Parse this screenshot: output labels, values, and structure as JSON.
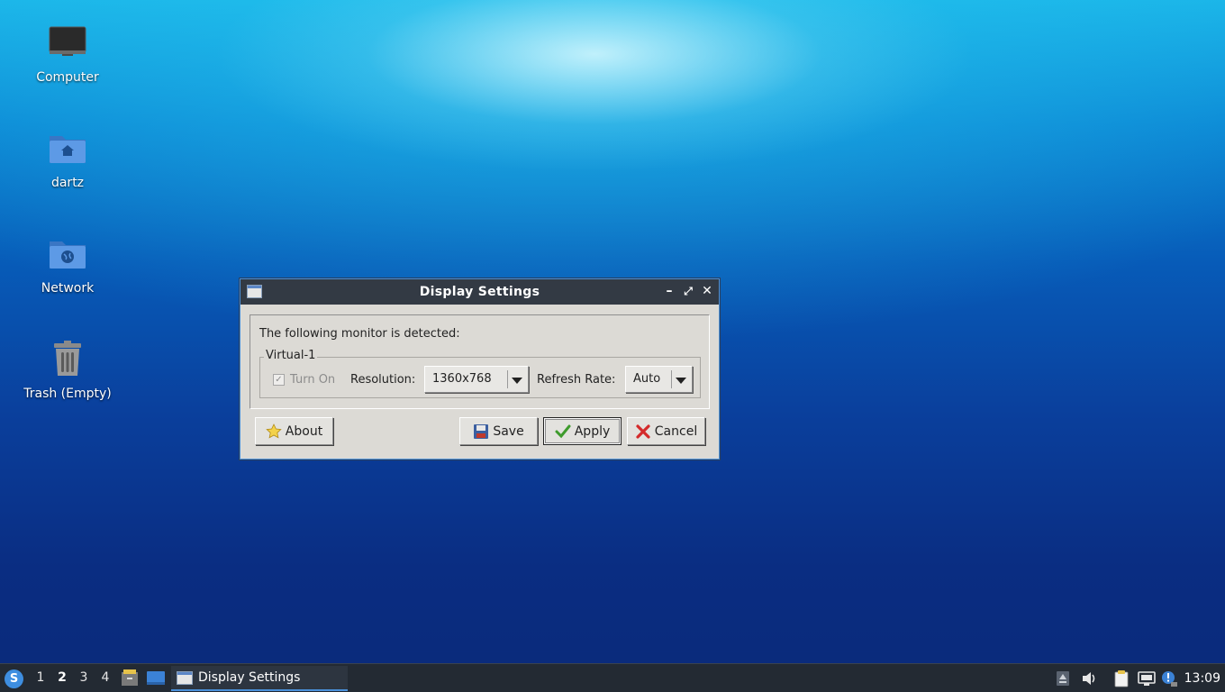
{
  "desktop": {
    "icons": [
      {
        "label": "Computer"
      },
      {
        "label": "dartz"
      },
      {
        "label": "Network"
      },
      {
        "label": "Trash (Empty)"
      }
    ]
  },
  "dialog": {
    "title": "Display Settings",
    "detected_text": "The following monitor is detected:",
    "monitor_name": "Virtual-1",
    "turn_on_label": "Turn On",
    "turn_on_checked": true,
    "turn_on_enabled": false,
    "resolution_label": "Resolution:",
    "resolution_value": "1360x768",
    "refresh_label": "Refresh Rate:",
    "refresh_value": "Auto",
    "buttons": {
      "about": "About",
      "save": "Save",
      "apply": "Apply",
      "cancel": "Cancel"
    }
  },
  "taskbar": {
    "workspaces": [
      "1",
      "2",
      "3",
      "4"
    ],
    "active_workspace": "2",
    "task_title": "Display Settings",
    "clock": "13:09"
  },
  "colors": {
    "accent": "#4a90d9",
    "titlebar": "#333a44",
    "dialog_bg": "#dcdad5",
    "taskbar_bg": "#232a33"
  }
}
